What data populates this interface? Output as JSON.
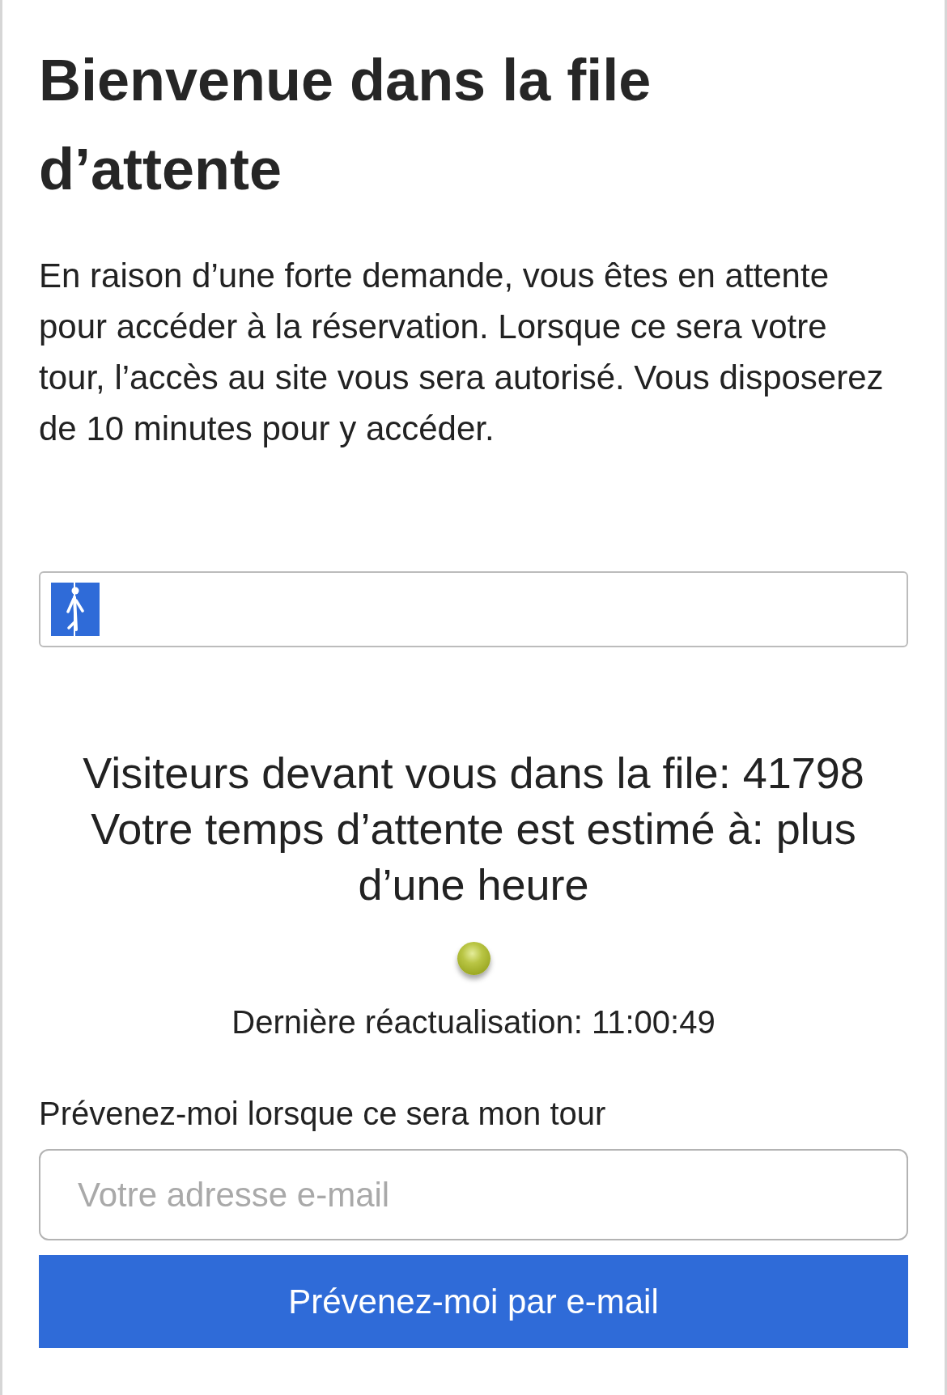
{
  "heading": "Bienvenue dans la file d’attente",
  "intro": "En raison d’une forte demande, vous êtes en attente pour accéder à la réservation. Lorsque ce sera votre tour, l’accès au site vous sera autorisé. Vous disposerez de 10 minutes pour y accéder.",
  "progress": {
    "level": 0.057
  },
  "queue_status": [
    "Visiteurs devant vous dans la file: 41798",
    "Votre temps d’attente est estimé à: plus d’une heure"
  ],
  "last_refresh": "Dernière réactualisation: 11:00:49",
  "notify": {
    "label": "Prévenez-moi lorsque ce sera mon tour",
    "email_field": {
      "placeholder": "Votre adresse e-mail"
    },
    "button": "Prévenez-moi par e-mail"
  }
}
